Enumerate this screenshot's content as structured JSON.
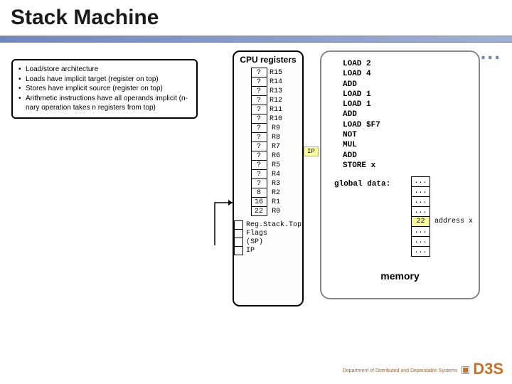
{
  "title": "Stack Machine",
  "bullets": [
    "Load/store architecture",
    "Loads have implicit target (register on top)",
    "Stores have implicit source (register on top)",
    "Arithmetic instructions have all operands implicit (n-nary operation takes n registers from top)"
  ],
  "cpu": {
    "title": "CPU registers",
    "regs": [
      {
        "v": "?",
        "n": "R15"
      },
      {
        "v": "?",
        "n": "R14"
      },
      {
        "v": "?",
        "n": "R13"
      },
      {
        "v": "?",
        "n": "R12"
      },
      {
        "v": "?",
        "n": "R11"
      },
      {
        "v": "?",
        "n": "R10"
      },
      {
        "v": "?",
        "n": "R9"
      },
      {
        "v": "?",
        "n": "R8"
      },
      {
        "v": "?",
        "n": "R7"
      },
      {
        "v": "?",
        "n": "R6"
      },
      {
        "v": "?",
        "n": "R5"
      },
      {
        "v": "?",
        "n": "R4"
      },
      {
        "v": "?",
        "n": "R3"
      },
      {
        "v": "8",
        "n": "R2"
      },
      {
        "v": "16",
        "n": "R1"
      },
      {
        "v": "22",
        "n": "R0"
      }
    ],
    "extra": [
      "Reg.Stack.Top",
      "Flags",
      "(SP)",
      "IP"
    ]
  },
  "ip_label": "IP",
  "asm": [
    "LOAD 2",
    "LOAD 4",
    "ADD",
    "LOAD 1",
    "LOAD 1",
    "ADD",
    "LOAD $F7",
    "NOT",
    "MUL",
    "ADD",
    "STORE x"
  ],
  "global_label": "global data:",
  "mem_cells": [
    {
      "v": "...",
      "h": false,
      "s": ""
    },
    {
      "v": "...",
      "h": false,
      "s": ""
    },
    {
      "v": "...",
      "h": false,
      "s": ""
    },
    {
      "v": "...",
      "h": false,
      "s": ""
    },
    {
      "v": "22",
      "h": true,
      "s": "address x"
    },
    {
      "v": "...",
      "h": false,
      "s": ""
    },
    {
      "v": "...",
      "h": false,
      "s": ""
    },
    {
      "v": "...",
      "h": false,
      "s": ""
    }
  ],
  "mem_title": "memory",
  "footer": {
    "dept": "Department of Distributed and Dependable Systems",
    "brand": "D3S"
  }
}
